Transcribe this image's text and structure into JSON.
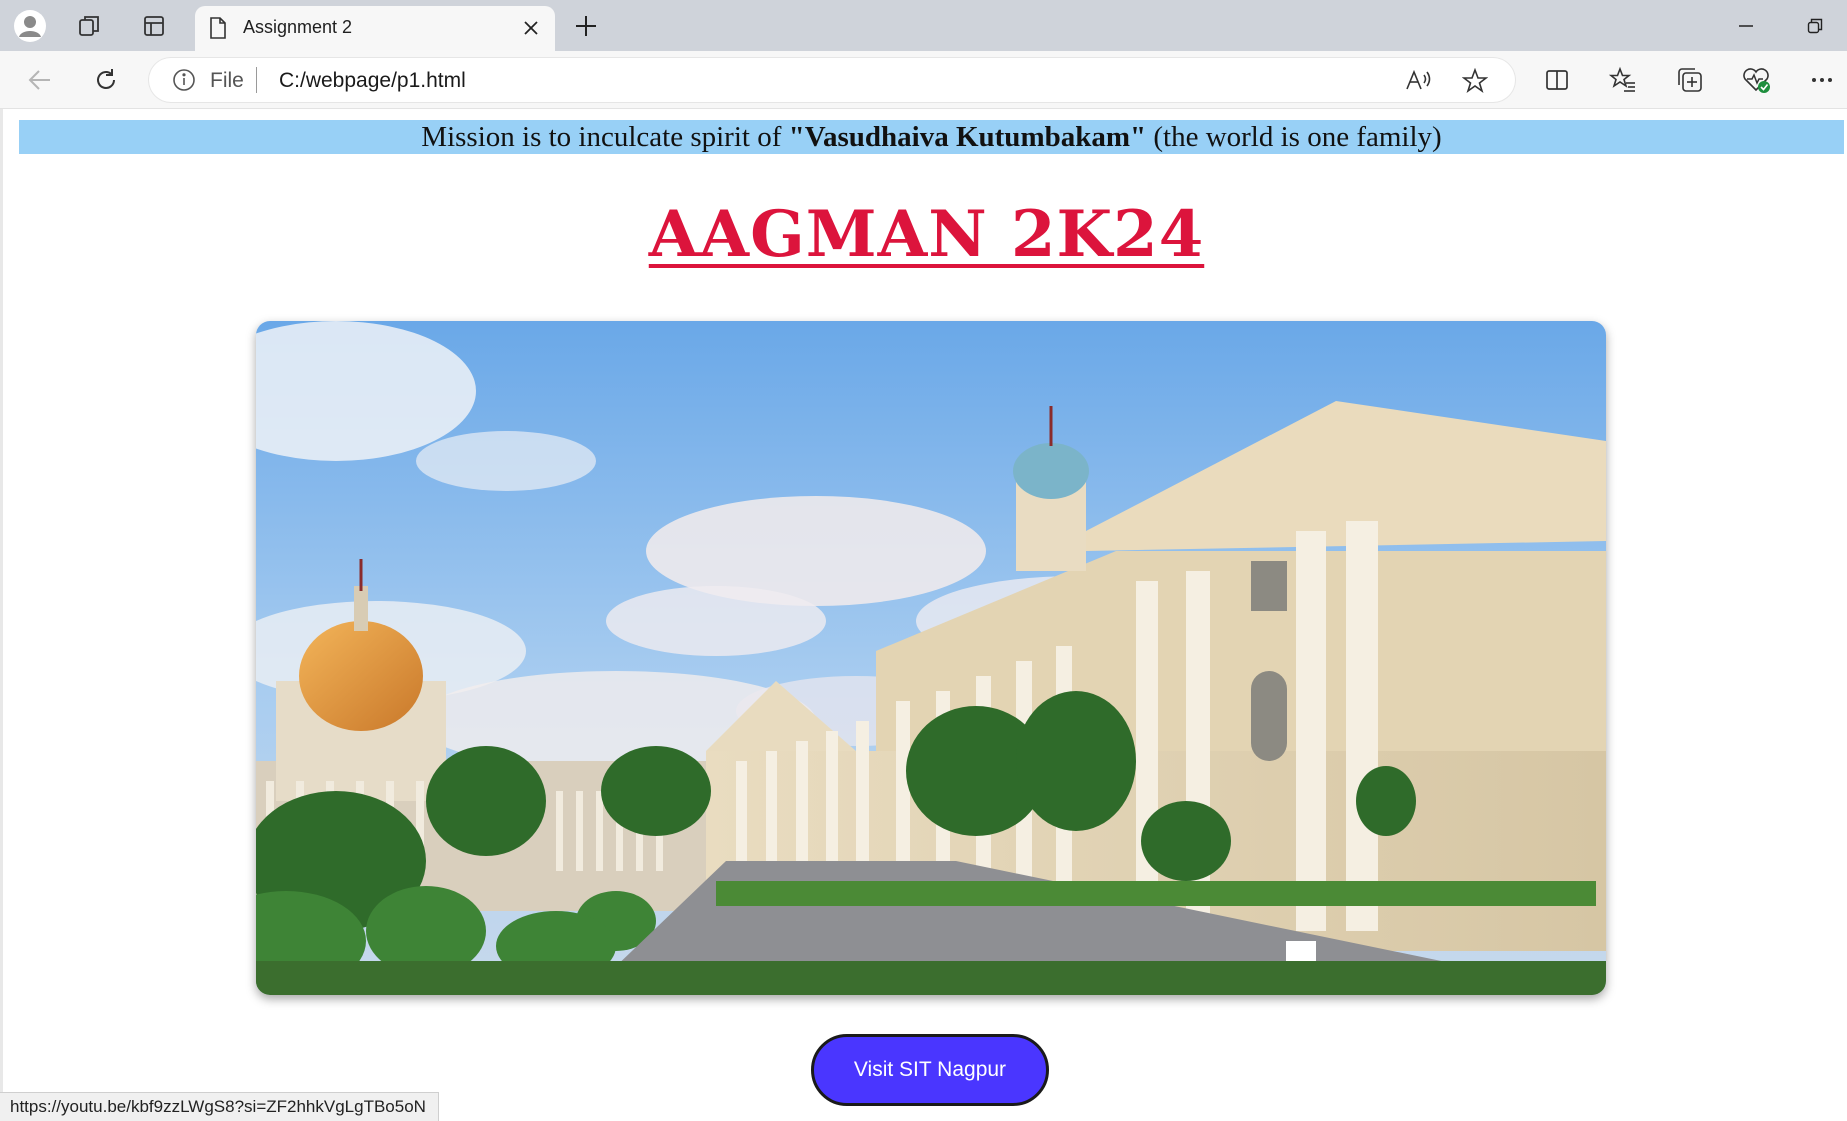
{
  "browser": {
    "tab_title": "Assignment 2",
    "address_scheme": "File",
    "address_url": "C:/webpage/p1.html"
  },
  "page": {
    "mission_prefix": "Mission is to inculcate spirit of ",
    "mission_bold": "\"Vasudhaiva Kutumbakam\"",
    "mission_suffix": " (the world is one family)",
    "heading": "AAGMAN 2K24",
    "button_label": "Visit SIT Nagpur",
    "status_url": "https://youtu.be/kbf9zzLWgS8?si=ZF2hhkVgLgTBo5oN"
  },
  "colors": {
    "mission_bg": "#98d0f6",
    "heading": "#dc143c",
    "button_bg": "#4a36ff"
  }
}
